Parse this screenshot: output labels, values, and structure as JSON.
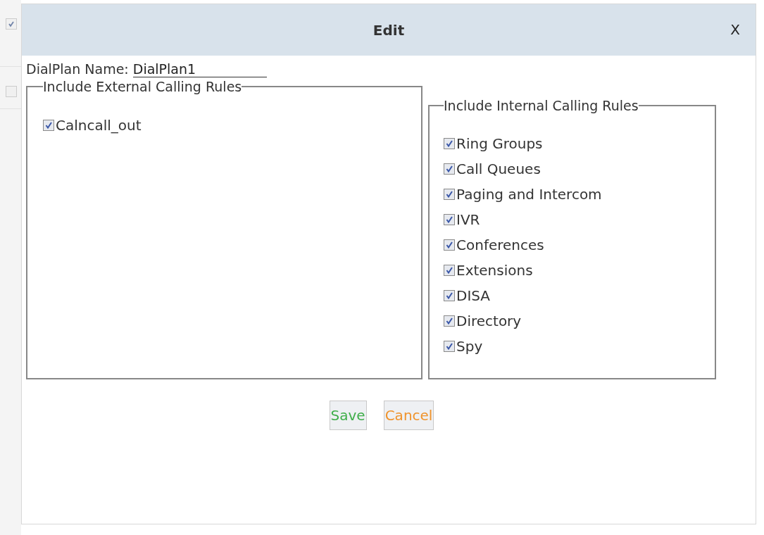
{
  "background_checkboxes": [
    {
      "checked": true
    },
    {
      "checked": false
    }
  ],
  "dialog": {
    "title": "Edit",
    "close": "X"
  },
  "name_field": {
    "label": "DialPlan Name:",
    "value": "DialPlan1"
  },
  "external_rules": {
    "legend": "Include External Calling Rules",
    "items": [
      {
        "label": "Calncall_out",
        "checked": true
      }
    ]
  },
  "internal_rules": {
    "legend": "Include Internal Calling Rules",
    "items": [
      {
        "label": "Ring Groups",
        "checked": true
      },
      {
        "label": "Call Queues",
        "checked": true
      },
      {
        "label": "Paging and Intercom",
        "checked": true
      },
      {
        "label": "IVR",
        "checked": true
      },
      {
        "label": "Conferences",
        "checked": true
      },
      {
        "label": "Extensions",
        "checked": true
      },
      {
        "label": "DISA",
        "checked": true
      },
      {
        "label": "Directory",
        "checked": true
      },
      {
        "label": "Spy",
        "checked": true
      }
    ]
  },
  "buttons": [
    {
      "label": "Save",
      "kind": "save"
    },
    {
      "label": "Cancel",
      "kind": "cancel"
    }
  ]
}
